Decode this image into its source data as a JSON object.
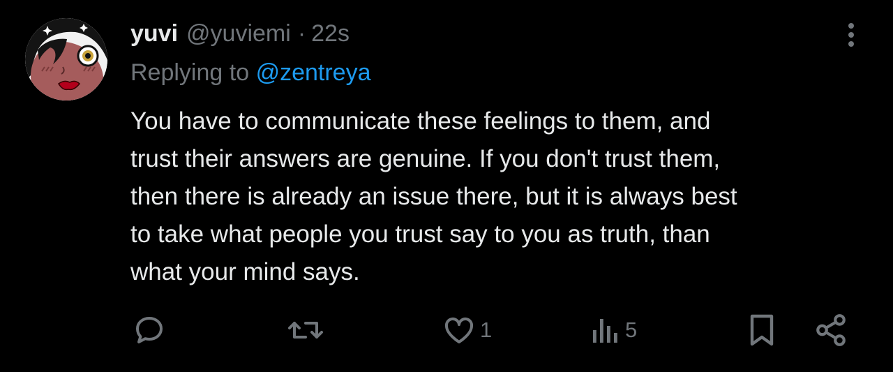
{
  "tweet": {
    "display_name": "yuvi",
    "handle": "@yuviemi",
    "separator": "·",
    "timestamp": "22s",
    "replying_prefix": "Replying to",
    "replying_to": "@zentreya",
    "text": "You have to communicate these feelings to them, and trust their answers are genuine. If you don't trust them, then there is already an issue there, but it is always best to take what people you trust say to you as truth, than what your mind says.",
    "text_lines": [
      "You have to communicate these feelings to them, and",
      "trust their answers are genuine. If you don't trust them,",
      "then there is already an issue there, but it is always best",
      "to take what people you trust say to you as truth, than",
      "what your mind says."
    ]
  },
  "actions": {
    "reply_icon": "reply-bubble-icon",
    "retweet_icon": "retweet-icon",
    "like_icon": "heart-icon",
    "like_count": "1",
    "views_icon": "views-bars-icon",
    "views_count": "5",
    "bookmark_icon": "bookmark-icon",
    "share_icon": "share-icon"
  },
  "colors": {
    "background": "#000000",
    "primary_text": "#e7e9ea",
    "secondary_text": "#71767b",
    "link": "#1d9bf0"
  }
}
